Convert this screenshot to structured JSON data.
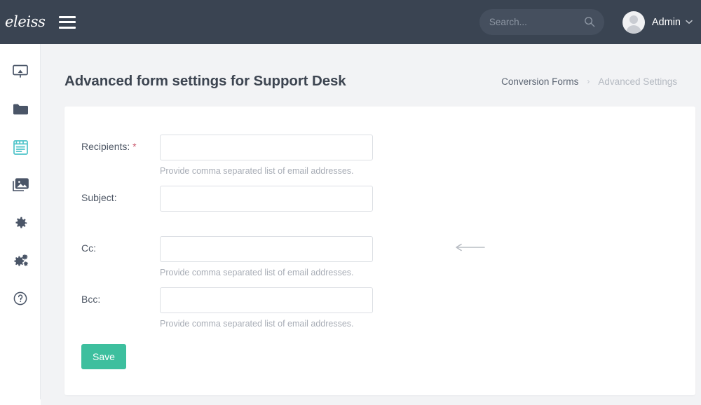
{
  "header": {
    "logo": "eleiss",
    "menu_icon": "hamburger-icon",
    "search": {
      "placeholder": "Search...",
      "value": "",
      "icon": "search-icon"
    },
    "user": {
      "name": "Admin",
      "avatar_icon": "user-avatar",
      "chevron": "⌄"
    },
    "background_color": "#3a4452"
  },
  "sidebar": {
    "items": [
      {
        "name": "dashboard",
        "icon": "monitor-icon",
        "active": false
      },
      {
        "name": "files",
        "icon": "folder-icon",
        "active": false
      },
      {
        "name": "conversion-forms",
        "icon": "form-list-icon",
        "active": true
      },
      {
        "name": "media",
        "icon": "images-icon",
        "active": false
      },
      {
        "name": "settings",
        "icon": "gear-icon",
        "active": false
      },
      {
        "name": "advanced-settings",
        "icon": "gears-icon",
        "active": false
      },
      {
        "name": "help",
        "icon": "question-circle-icon",
        "active": false
      }
    ],
    "active_color": "#4ec4c9",
    "icon_color": "#4a5567"
  },
  "page": {
    "title": "Advanced form settings for Support Desk",
    "breadcrumb": {
      "parent": "Conversion Forms",
      "separator": "›",
      "current": "Advanced Settings"
    },
    "background_color": "#f2f3f5"
  },
  "form": {
    "fields": [
      {
        "label": "Recipients:",
        "required": true,
        "required_mark": "*",
        "value": "",
        "placeholder": "",
        "hint": "Provide comma separated list of email addresses.",
        "annotated": false
      },
      {
        "label": "Subject:",
        "required": false,
        "required_mark": "",
        "value": "",
        "placeholder": "",
        "hint": "",
        "annotated": false
      },
      {
        "label": "Cc:",
        "required": false,
        "required_mark": "",
        "value": "",
        "placeholder": "",
        "hint": "Provide comma separated list of email addresses.",
        "annotated": true
      },
      {
        "label": "Bcc:",
        "required": false,
        "required_mark": "",
        "value": "",
        "placeholder": "",
        "hint": "Provide comma separated list of email addresses.",
        "annotated": false
      }
    ],
    "save_label": "Save",
    "save_color": "#3dbf9e",
    "required_color": "#c9576c",
    "annotation_icon": "left-arrow-annotation"
  }
}
